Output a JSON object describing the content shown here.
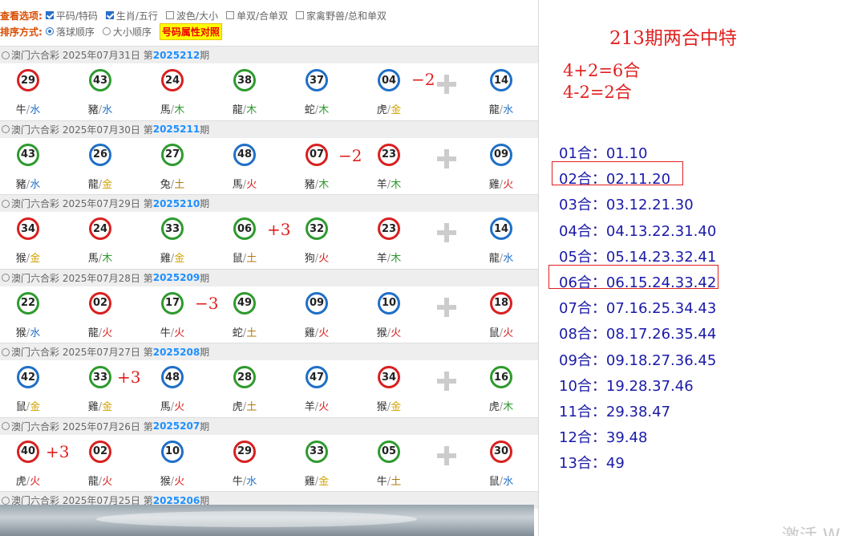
{
  "options": {
    "view_label": "查看选项:",
    "view": [
      {
        "text": "平码/特码",
        "checked": true
      },
      {
        "text": "生肖/五行",
        "checked": true
      },
      {
        "text": "波色/大小",
        "checked": false
      },
      {
        "text": "单双/合单双",
        "checked": false
      },
      {
        "text": "家禽野兽/总和单双",
        "checked": false
      }
    ],
    "sort_label": "排序方式:",
    "sort": [
      {
        "text": "落球顺序",
        "checked": true
      },
      {
        "text": "大小顺序",
        "checked": false
      }
    ],
    "highlight": "号码属性对照"
  },
  "draws": [
    {
      "prefix": "澳门六合彩 2025年07月31日 第",
      "issue": "2025212",
      "suffix": "期",
      "balls": [
        {
          "n": "29",
          "c": "red",
          "z": "牛",
          "e": "水"
        },
        {
          "n": "43",
          "c": "green",
          "z": "豬",
          "e": "水"
        },
        {
          "n": "24",
          "c": "red",
          "z": "馬",
          "e": "木"
        },
        {
          "n": "38",
          "c": "green",
          "z": "龍",
          "e": "木"
        },
        {
          "n": "37",
          "c": "blue",
          "z": "蛇",
          "e": "木"
        },
        {
          "n": "04",
          "c": "blue",
          "z": "虎",
          "e": "金"
        },
        {
          "n": "14",
          "c": "blue",
          "z": "龍",
          "e": "水"
        }
      ],
      "note": "−2"
    },
    {
      "prefix": "澳门六合彩 2025年07月30日 第",
      "issue": "2025211",
      "suffix": "期",
      "balls": [
        {
          "n": "43",
          "c": "green",
          "z": "豬",
          "e": "水"
        },
        {
          "n": "26",
          "c": "blue",
          "z": "龍",
          "e": "金"
        },
        {
          "n": "27",
          "c": "green",
          "z": "兔",
          "e": "土"
        },
        {
          "n": "48",
          "c": "blue",
          "z": "馬",
          "e": "火"
        },
        {
          "n": "07",
          "c": "red",
          "z": "豬",
          "e": "木"
        },
        {
          "n": "23",
          "c": "red",
          "z": "羊",
          "e": "木"
        },
        {
          "n": "09",
          "c": "blue",
          "z": "雞",
          "e": "火"
        }
      ],
      "note": "−2"
    },
    {
      "prefix": "澳门六合彩 2025年07月29日 第",
      "issue": "2025210",
      "suffix": "期",
      "balls": [
        {
          "n": "34",
          "c": "red",
          "z": "猴",
          "e": "金"
        },
        {
          "n": "24",
          "c": "red",
          "z": "馬",
          "e": "木"
        },
        {
          "n": "33",
          "c": "green",
          "z": "雞",
          "e": "金"
        },
        {
          "n": "06",
          "c": "green",
          "z": "鼠",
          "e": "土"
        },
        {
          "n": "32",
          "c": "green",
          "z": "狗",
          "e": "火"
        },
        {
          "n": "23",
          "c": "red",
          "z": "羊",
          "e": "木"
        },
        {
          "n": "14",
          "c": "blue",
          "z": "龍",
          "e": "水"
        }
      ],
      "note": "+3"
    },
    {
      "prefix": "澳门六合彩 2025年07月28日 第",
      "issue": "2025209",
      "suffix": "期",
      "balls": [
        {
          "n": "22",
          "c": "green",
          "z": "猴",
          "e": "水"
        },
        {
          "n": "02",
          "c": "red",
          "z": "龍",
          "e": "火"
        },
        {
          "n": "17",
          "c": "green",
          "z": "牛",
          "e": "火"
        },
        {
          "n": "49",
          "c": "green",
          "z": "蛇",
          "e": "土"
        },
        {
          "n": "09",
          "c": "blue",
          "z": "雞",
          "e": "火"
        },
        {
          "n": "10",
          "c": "blue",
          "z": "猴",
          "e": "火"
        },
        {
          "n": "18",
          "c": "red",
          "z": "鼠",
          "e": "火"
        }
      ],
      "note": "−3"
    },
    {
      "prefix": "澳门六合彩 2025年07月27日 第",
      "issue": "2025208",
      "suffix": "期",
      "balls": [
        {
          "n": "42",
          "c": "blue",
          "z": "鼠",
          "e": "金"
        },
        {
          "n": "33",
          "c": "green",
          "z": "雞",
          "e": "金"
        },
        {
          "n": "48",
          "c": "blue",
          "z": "馬",
          "e": "火"
        },
        {
          "n": "28",
          "c": "green",
          "z": "虎",
          "e": "土"
        },
        {
          "n": "47",
          "c": "blue",
          "z": "羊",
          "e": "火"
        },
        {
          "n": "34",
          "c": "red",
          "z": "猴",
          "e": "金"
        },
        {
          "n": "16",
          "c": "green",
          "z": "虎",
          "e": "木"
        }
      ],
      "note": "+3"
    },
    {
      "prefix": "澳门六合彩 2025年07月26日 第",
      "issue": "2025207",
      "suffix": "期",
      "balls": [
        {
          "n": "40",
          "c": "red",
          "z": "虎",
          "e": "火"
        },
        {
          "n": "02",
          "c": "red",
          "z": "龍",
          "e": "火"
        },
        {
          "n": "10",
          "c": "blue",
          "z": "猴",
          "e": "火"
        },
        {
          "n": "29",
          "c": "red",
          "z": "牛",
          "e": "水"
        },
        {
          "n": "33",
          "c": "green",
          "z": "雞",
          "e": "金"
        },
        {
          "n": "05",
          "c": "green",
          "z": "牛",
          "e": "土"
        },
        {
          "n": "30",
          "c": "red",
          "z": "鼠",
          "e": "水"
        }
      ],
      "note": "+3"
    },
    {
      "prefix": "澳门六合彩 2025年07月25日 第",
      "issue": "2025206",
      "suffix": "期",
      "balls": [],
      "note": ""
    }
  ],
  "right": {
    "title": "213期两合中特",
    "calc1": "4+2=6合",
    "calc2": "4-2=2合",
    "groups": [
      "01合：01.10",
      "02合：02.11.20",
      "03合：03.12.21.30",
      "04合：04.13.22.31.40",
      "05合：05.14.23.32.41",
      "06合：06.15.24.33.42",
      "07合：07.16.25.34.43",
      "08合：08.17.26.35.44",
      "09合：09.18.27.36.45",
      "10合：19.28.37.46",
      "11合：29.38.47",
      "12合：39.48",
      "13合：49"
    ],
    "boxed": [
      "02合：02.11.20",
      "06合：06.15.24.33.42"
    ]
  },
  "watermark": "激活 W"
}
